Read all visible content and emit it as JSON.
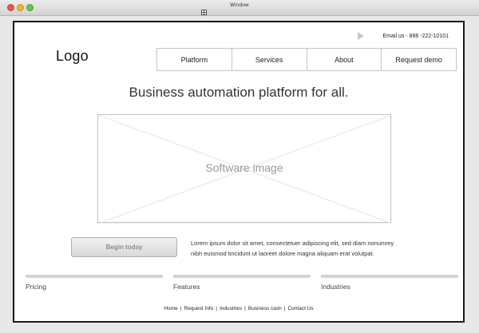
{
  "window": {
    "title": "Window"
  },
  "header": {
    "contact": "Email us  -  888 -222-10101",
    "logo": "Logo"
  },
  "nav": {
    "items": [
      {
        "label": "Platform"
      },
      {
        "label": "Services"
      },
      {
        "label": "About"
      },
      {
        "label": "Request demo"
      }
    ]
  },
  "hero": {
    "headline": "Business automation platform for all.",
    "image_label": "Software image"
  },
  "cta": {
    "button_label": "Begin today",
    "description_line1": "Lorem ipsum dolor sit amet, consectetuer adipiscing elit, sed diam nonummy",
    "description_line2": "nibh euismod tincidunt ut laoreet dolore magna aliquam erat volutpat."
  },
  "columns": [
    {
      "label": "Pricing"
    },
    {
      "label": "Features"
    },
    {
      "label": "Industries"
    }
  ],
  "footer": {
    "links": [
      "Home",
      "Request Info",
      "Industries",
      "Business cash",
      "Contact Us"
    ]
  },
  "colors": {
    "window_chrome": "#e8e8e8",
    "content_border": "#1a1a1a",
    "wireframe_gray": "#c4c4c4",
    "button_text": "#8c8c8c"
  },
  "icons": [
    "close-light-icon",
    "minimize-light-icon",
    "zoom-light-icon",
    "resize-handle-icon",
    "play-icon"
  ]
}
